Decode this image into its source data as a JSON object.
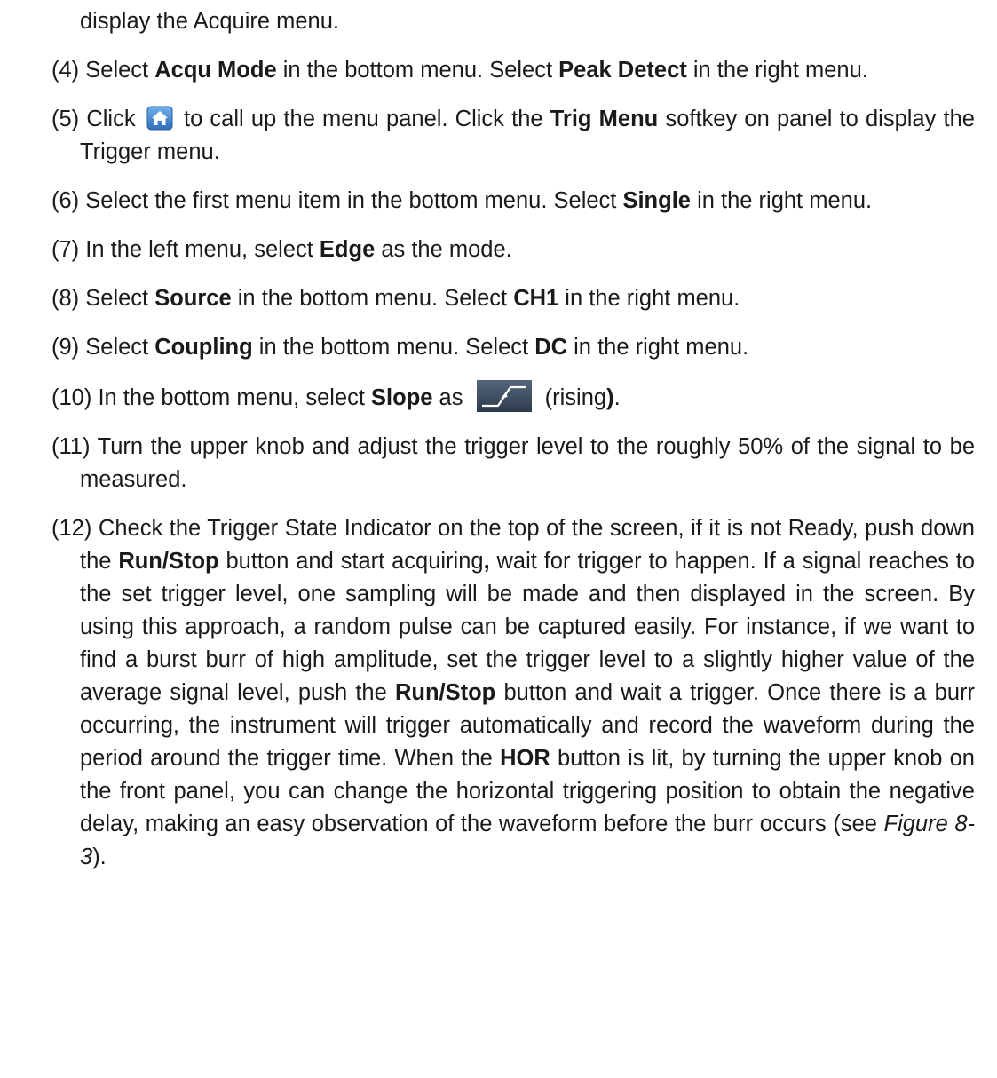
{
  "lines": {
    "l0": "display the Acquire menu.",
    "s4": {
      "num": "(4)",
      "a": " Select ",
      "b1": "Acqu Mode",
      "c": " in the bottom menu. Select ",
      "b2": "Peak Detect",
      "d": " in the right menu."
    },
    "s5": {
      "num": "(5)",
      "a": " Click ",
      "icon": "home-icon",
      "b": " to call up the menu panel. Click the ",
      "b1": "Trig Menu",
      "c": " softkey on panel to display the Trigger menu."
    },
    "s6": {
      "num": "(6)",
      "a": " Select the first menu item in the bottom menu. Select ",
      "b1": "Single",
      "c": " in the right menu."
    },
    "s7": {
      "num": "(7)",
      "a": " In the left menu, select ",
      "b1": "Edge",
      "c": " as the mode."
    },
    "s8": {
      "num": "(8)",
      "a": " Select ",
      "b1": "Source",
      "b": " in the bottom menu. Select ",
      "b2": "CH1",
      "c": " in the right menu."
    },
    "s9": {
      "num": "(9)",
      "a": " Select ",
      "b1": "Coupling",
      "b": " in the bottom menu. Select ",
      "b2": "DC",
      "c": " in the right menu."
    },
    "s10": {
      "num": "(10)",
      "a": " In the bottom menu, select ",
      "b1": "Slope",
      "b": " as ",
      "icon": "rising-slope-icon",
      "c": " (rising",
      "b2": ")",
      "d": "."
    },
    "s11": {
      "num": "(11)",
      "a": " Turn the upper knob and adjust the trigger level to the roughly 50% of the signal to be measured."
    },
    "s12": {
      "num": "(12)",
      "a": " Check the Trigger State Indicator on the top of the screen, if it is not Ready, push down the ",
      "b1": "Run/Stop",
      "b": " button and start acquiring",
      "b2": ",",
      "c": " wait for trigger to happen. If a signal reaches to the set trigger level, one sampling will be made and then displayed in the screen. By using this approach, a random pulse can be captured easily. For instance, if we want to find a burst burr of high amplitude, set the trigger level to a slightly higher value of the average signal level, push the ",
      "b3": "Run/Stop",
      "d": " button and wait a trigger. Once there is a burr occurring, the instrument will trigger automatically and record the waveform during the period around the trigger time. When the ",
      "b4": "HOR",
      "e": " button is lit, by turning the upper knob on the front panel, you can change the horizontal triggering position to obtain the negative delay, making an easy observation of the waveform before the burr occurs (see ",
      "i1": "Figure 8-3",
      "f": ")."
    }
  },
  "colors": {
    "home_icon_bg": "#4a90d9",
    "slope_icon_bg": "#3f4f63"
  }
}
